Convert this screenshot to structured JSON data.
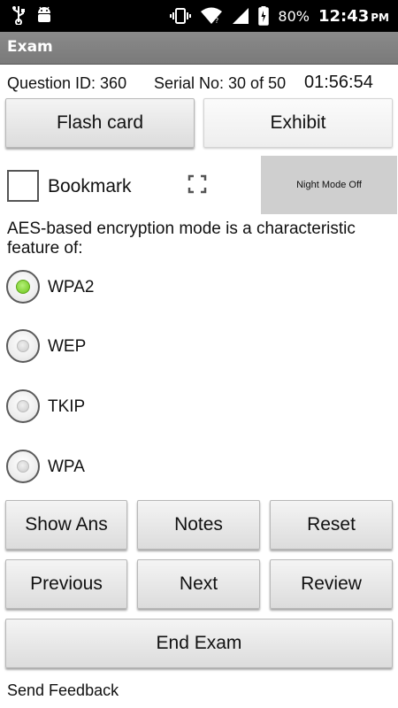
{
  "status_bar": {
    "icons_left": [
      "usb-icon",
      "android-icon"
    ],
    "icons_right": [
      "vibrate-icon",
      "wifi-icon",
      "signal-icon",
      "battery-icon"
    ],
    "battery": "80%",
    "time": "12:43",
    "ampm": "PM"
  },
  "app_bar": {
    "title": "Exam",
    "color": "#808080"
  },
  "info": {
    "question_id": "Question ID: 360",
    "serial": "Serial No: 30 of 50",
    "timer": "01:56:54"
  },
  "top_buttons": {
    "flash_card": "Flash card",
    "exhibit": "Exhibit"
  },
  "bookmark": {
    "label": "Bookmark",
    "checked": false
  },
  "night_mode": {
    "label": "Night Mode Off"
  },
  "question": {
    "text": "AES-based encryption mode is a characteristic feature of:"
  },
  "options": [
    {
      "label": "WPA2",
      "selected": true
    },
    {
      "label": "WEP",
      "selected": false
    },
    {
      "label": "TKIP",
      "selected": false
    },
    {
      "label": "WPA",
      "selected": false
    }
  ],
  "buttons": {
    "show_ans": "Show Ans",
    "notes": "Notes",
    "reset": "Reset",
    "previous": "Previous",
    "next": "Next",
    "review": "Review",
    "end_exam": "End Exam"
  },
  "footer": {
    "send_feedback": "Send Feedback"
  },
  "colors": {
    "selected_radio": "#6ac417",
    "night_mode_bg": "#cfcfcf"
  }
}
